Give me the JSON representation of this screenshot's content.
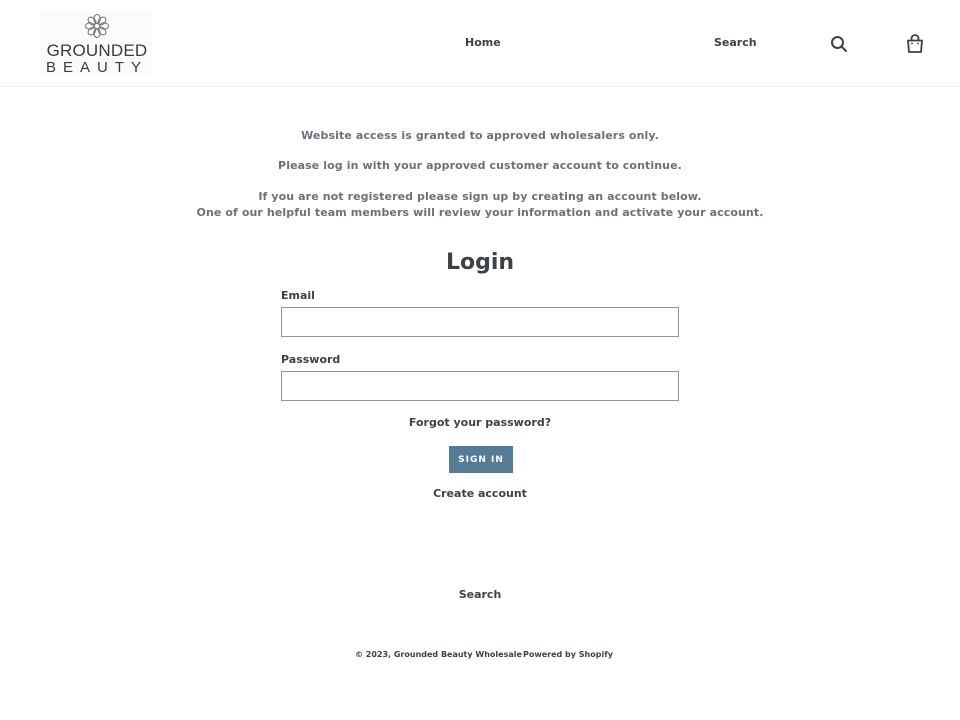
{
  "header": {
    "logo": {
      "line1": "GROUNDED",
      "line2": "BEAUTY"
    },
    "nav": {
      "home": "Home",
      "search": "Search"
    },
    "icons": {
      "search": "search-icon",
      "cart": "cart-icon"
    }
  },
  "notice": {
    "line1": "Website access is granted to approved wholesalers only.",
    "line2": "Please log in with your approved customer account to continue.",
    "line3": "If you are not registered please sign up by creating an account below.",
    "line4": "One of our helpful team members will review your information and activate your account."
  },
  "login": {
    "title": "Login",
    "email_label": "Email",
    "email_value": "",
    "password_label": "Password",
    "password_value": "",
    "forgot_link": "Forgot your password?",
    "submit_label": "Sign In",
    "create_link": "Create account"
  },
  "footer": {
    "search_link": "Search",
    "copyright": "© 2023, Grounded Beauty Wholesale",
    "powered_by": "Powered by Shopify"
  },
  "colors": {
    "accent": "#557b97",
    "text": "#3d4246",
    "muted": "#69727b"
  }
}
